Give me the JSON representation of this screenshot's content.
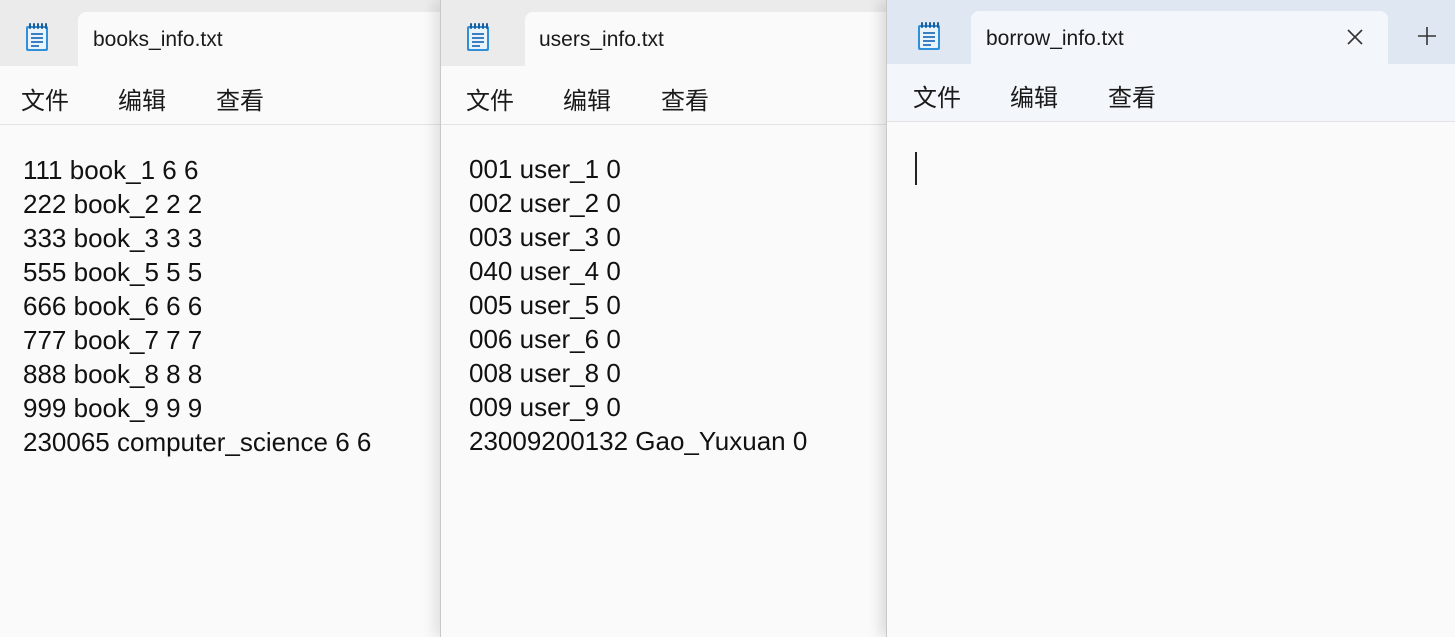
{
  "windows": [
    {
      "tab_title": "books_info.txt",
      "menu": {
        "file": "文件",
        "edit": "编辑",
        "view": "查看"
      },
      "lines": [
        "111 book_1 6 6",
        "222 book_2 2 2",
        "333 book_3 3 3",
        "555 book_5 5 5",
        "666 book_6 6 6",
        "777 book_7 7 7",
        "888 book_8 8 8",
        "999 book_9 9 9",
        "230065 computer_science 6 6"
      ]
    },
    {
      "tab_title": "users_info.txt",
      "menu": {
        "file": "文件",
        "edit": "编辑",
        "view": "查看"
      },
      "lines": [
        "001 user_1 0",
        "002 user_2 0",
        "003 user_3 0",
        "040 user_4 0",
        "005 user_5 0",
        "006 user_6 0",
        "008 user_8 0",
        "009 user_9 0",
        "23009200132 Gao_Yuxuan 0"
      ]
    },
    {
      "tab_title": "borrow_info.txt",
      "menu": {
        "file": "文件",
        "edit": "编辑",
        "view": "查看"
      },
      "lines": []
    }
  ],
  "icons": {
    "app": "notepad-icon",
    "close": "close-icon",
    "new_tab": "plus-icon"
  },
  "colors": {
    "accent_tabbar_active": "#dfe8f2",
    "notepad_icon_blue": "#2f8fd8"
  }
}
